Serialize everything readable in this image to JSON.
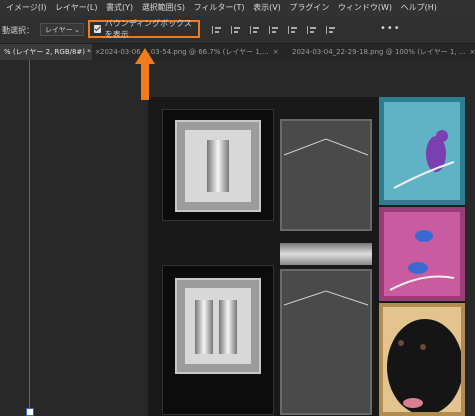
{
  "menubar": {
    "items": [
      "イメージ(I)",
      "レイヤー(L)",
      "書式(Y)",
      "選択範囲(S)",
      "フィルター(T)",
      "表示(V)",
      "プラグイン",
      "ウィンドウ(W)",
      "ヘルプ(H)"
    ]
  },
  "options": {
    "auto_select_label": "動選択：",
    "target_select": "レイヤー",
    "bounding_box_label": "バウンディングボックスを表示",
    "bounding_box_checked": true,
    "more_label": "•••"
  },
  "tabs": [
    {
      "label": "% (レイヤー 2, RGB/8#) *",
      "active": true
    },
    {
      "label": "2024-03-06_...03-54.png @ 66.7% (レイヤー 1,...",
      "active": false
    },
    {
      "label": "2024-03-04_22-29-18.png @ 100% (レイヤー 1, ...",
      "active": false
    }
  ],
  "colors": {
    "highlight": "#f27c1c",
    "guide": "#3a63c8"
  },
  "icons": [
    "checkbox-icon",
    "chevron-down-icon",
    "align-left-icon",
    "align-center-icon",
    "align-right-icon",
    "distribute-icon",
    "more-icon",
    "close-icon",
    "orange-up-arrow"
  ]
}
